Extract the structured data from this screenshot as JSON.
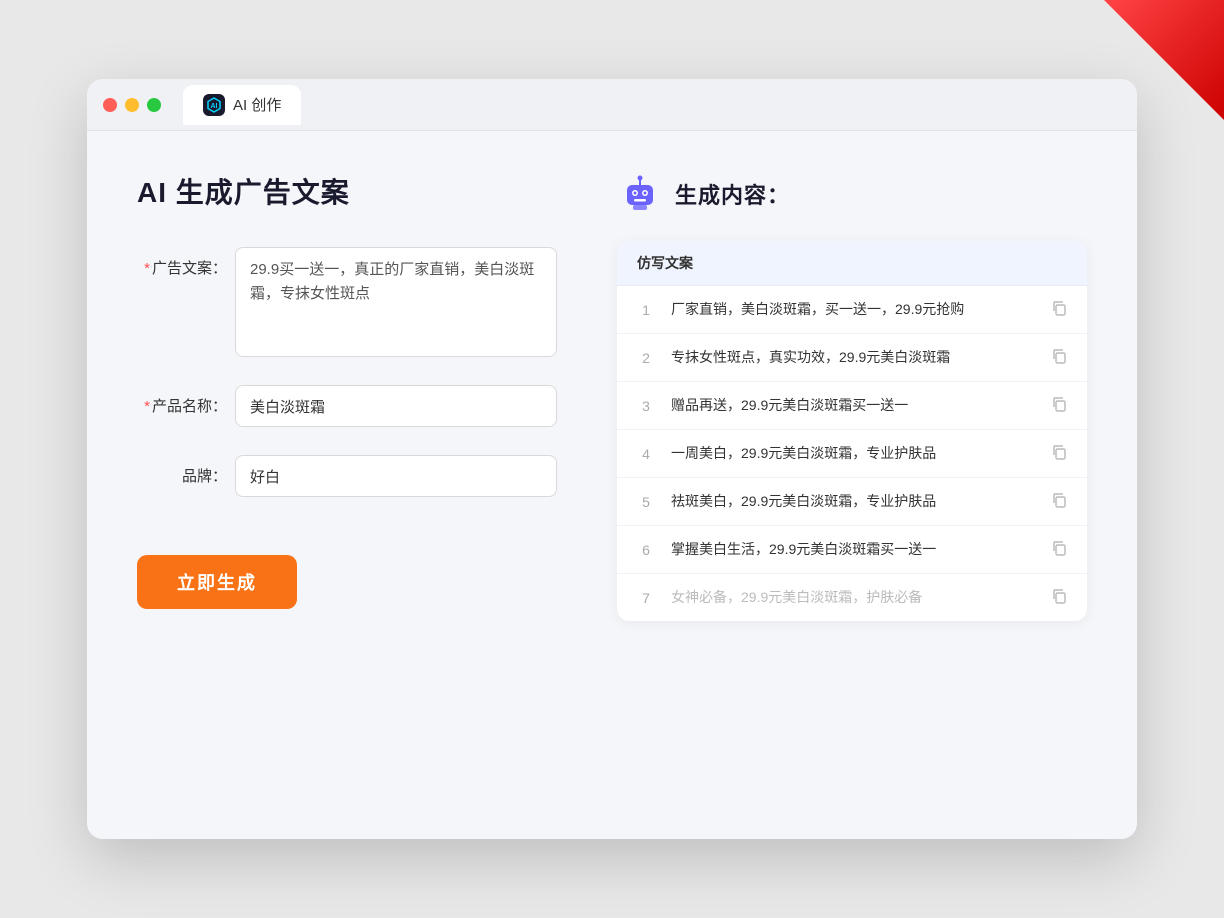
{
  "browser": {
    "tab_title": "AI 创作",
    "tab_icon_text": "AI"
  },
  "left_panel": {
    "page_title": "AI 生成广告文案",
    "fields": {
      "ad_copy_label": "广告文案：",
      "ad_copy_required": "*",
      "ad_copy_value": "29.9买一送一，真正的厂家直销，美白淡斑霜，专抹女性斑点",
      "product_name_label": "产品名称：",
      "product_name_required": "*",
      "product_name_value": "美白淡斑霜",
      "brand_label": "品牌：",
      "brand_value": "好白"
    },
    "generate_button": "立即生成"
  },
  "right_panel": {
    "title": "生成内容：",
    "table_header": "仿写文案",
    "rows": [
      {
        "num": "1",
        "text": "厂家直销，美白淡斑霜，买一送一，29.9元抢购",
        "muted": false
      },
      {
        "num": "2",
        "text": "专抹女性斑点，真实功效，29.9元美白淡斑霜",
        "muted": false
      },
      {
        "num": "3",
        "text": "赠品再送，29.9元美白淡斑霜买一送一",
        "muted": false
      },
      {
        "num": "4",
        "text": "一周美白，29.9元美白淡斑霜，专业护肤品",
        "muted": false
      },
      {
        "num": "5",
        "text": "祛斑美白，29.9元美白淡斑霜，专业护肤品",
        "muted": false
      },
      {
        "num": "6",
        "text": "掌握美白生活，29.9元美白淡斑霜买一送一",
        "muted": false
      },
      {
        "num": "7",
        "text": "女神必备，29.9元美白淡斑霜，护肤必备",
        "muted": true
      }
    ]
  }
}
